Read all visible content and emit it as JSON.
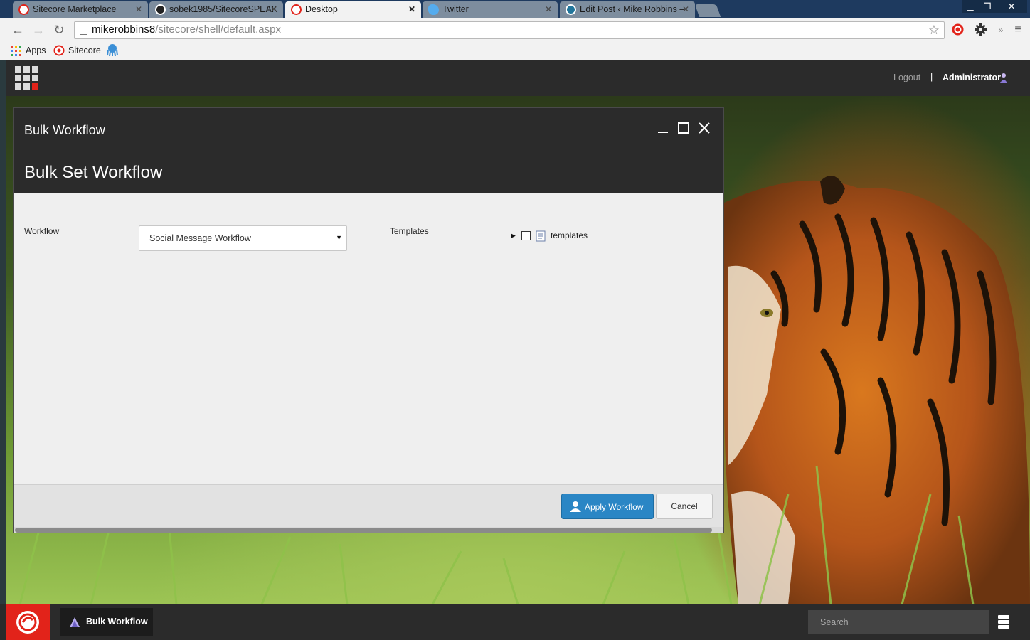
{
  "browser": {
    "tabs": [
      {
        "title": "Sitecore Marketplace",
        "icon": "sitecore-icon",
        "active": false
      },
      {
        "title": "sobek1985/SitecoreSPEAK",
        "icon": "github-icon",
        "active": false
      },
      {
        "title": "Desktop",
        "icon": "sitecore-icon",
        "active": true
      },
      {
        "title": "Twitter",
        "icon": "twitter-icon",
        "active": false
      },
      {
        "title": "Edit Post ‹ Mike Robbins –",
        "icon": "wordpress-icon",
        "active": false
      }
    ],
    "url_host": "mikerobbins8",
    "url_path": "/sitecore/shell/default.aspx",
    "bookmarks": {
      "apps": "Apps",
      "sitecore": "Sitecore"
    }
  },
  "header": {
    "logout": "Logout",
    "separator": "|",
    "user": "Administrator"
  },
  "dialog": {
    "window_title": "Bulk Workflow",
    "title": "Bulk Set Workflow",
    "workflow_label": "Workflow",
    "workflow_value": "Social Message Workflow",
    "templates_label": "Templates",
    "tree_root": "templates",
    "apply_button": "Apply Workflow",
    "cancel_button": "Cancel"
  },
  "taskbar": {
    "active_app": "Bulk Workflow",
    "search_placeholder": "Search"
  },
  "colors": {
    "sitecore_red": "#e2231a",
    "header_dark": "#2b2b2b",
    "primary_button": "#2a86c5"
  }
}
